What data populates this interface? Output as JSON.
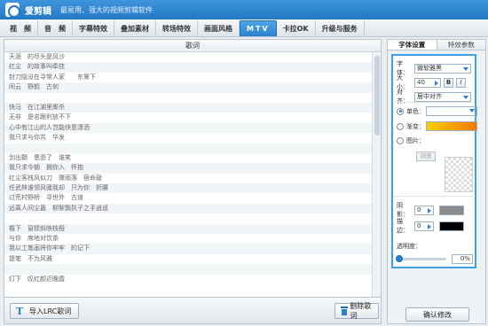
{
  "app": {
    "name": "爱剪辑",
    "slogan": "最易用、强大的视频剪辑软件"
  },
  "tabs": [
    {
      "label": "视　频"
    },
    {
      "label": "音　频"
    },
    {
      "label": "字幕特效"
    },
    {
      "label": "叠加素材"
    },
    {
      "label": "转场特效"
    },
    {
      "label": "画面风格"
    },
    {
      "label": "MTV",
      "active": true
    },
    {
      "label": "卡拉OK"
    },
    {
      "label": "升级与服务"
    }
  ],
  "lyrics": {
    "header": "歌词",
    "lines": [
      "天涯　的尽头是风沙",
      "红尘　的故事叫牵挂",
      "封刀隐没在寻常人家　　东篱下",
      "闲云　野鹤　古刹",
      "",
      "快马　在江湖里厮杀",
      "无非　是名跟利放不下",
      "心中有江山的人岂能快意潇洒",
      "我只求与你共　华发",
      "",
      "剑出鞘　恩怨了　谁笑",
      "我只求今朝　拥你入　怀抱",
      "红尘客栈风似刀　骤雨落　宿命敲",
      "任武林谁领风骚我却　只为你　折腰",
      "过荒村野桥　寻世外　古道",
      "远离人间尘嚣　柳絮飘执子之手逍遥",
      "",
      "檐下　窗棂斜映枝桠",
      "与你　席地对饮茶",
      "我以工笔画将你牢牢　的记下",
      "提笔　不为风雅",
      "",
      "灯下　叹红颜近晚霞"
    ]
  },
  "left_bottom": {
    "import_label": "导入LRC歌词",
    "delete_label": "删除歌词"
  },
  "right_panel": {
    "tabs": [
      {
        "label": "字体设置",
        "active": true
      },
      {
        "label": "特效参数"
      }
    ],
    "font_label": "字体：",
    "font_value": "微软雅黑",
    "size_label": "大小：",
    "size_value": "40",
    "bold_label": "B",
    "italic_label": "I",
    "align_label": "对齐：",
    "align_value": "居中对齐",
    "single_color_label": "单色：",
    "gradient_label": "渐变：",
    "image_label": "图片：",
    "browse_label": "浏览",
    "shadow_label": "阴影：",
    "shadow_value": "0",
    "stroke_label": "描边：",
    "stroke_value": "0",
    "opacity_label": "透明度：",
    "opacity_value": "0%",
    "confirm_label": "确认修改",
    "colors": {
      "single_color": "#ffffff",
      "gradient_start": "#f7d000",
      "gradient_end": "#f07800",
      "shadow_color": "#8a8a8a",
      "stroke_color": "#000000"
    }
  }
}
